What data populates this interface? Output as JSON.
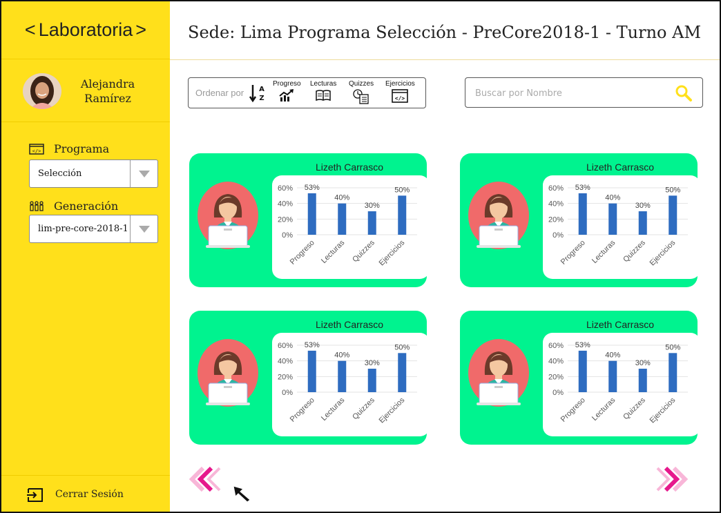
{
  "brand": {
    "name": "Laboratoria",
    "left_chevron": "<",
    "right_chevron": ">"
  },
  "user": {
    "first_name": "Alejandra",
    "last_name": "Ramírez"
  },
  "filters": {
    "programa_label": "Programa",
    "programa_value": "Selección",
    "generacion_label": "Generación",
    "generacion_value": "lim-pre-core-2018-1"
  },
  "logout_label": "Cerrar Sesión",
  "header": {
    "title": "Sede: Lima  Programa Selección - PreCore2018-1 - Turno AM"
  },
  "sort": {
    "label": "Ordenar por",
    "options": [
      "Progreso",
      "Lecturas",
      "Quizzes",
      "Ejercicios"
    ]
  },
  "search": {
    "placeholder": "Buscar por Nombre",
    "value": ""
  },
  "colors": {
    "sidebar": "#FFE01B",
    "card": "#00F38F",
    "bar": "#2E6CC0",
    "pager": "#E6188C"
  },
  "icons": {
    "sort_az": "sort-az-icon",
    "progreso": "trending-up-icon",
    "lecturas": "book-icon",
    "quizzes": "clock-checklist-icon",
    "ejercicios": "code-window-icon",
    "search": "search-icon",
    "logout": "logout-icon",
    "prev": "double-chevron-left-icon",
    "next": "double-chevron-right-icon"
  },
  "students": [
    {
      "name": "Lizeth Carrasco"
    },
    {
      "name": "Lizeth Carrasco"
    },
    {
      "name": "Lizeth Carrasco"
    },
    {
      "name": "Lizeth Carrasco"
    }
  ],
  "chart_data": [
    {
      "type": "bar",
      "categories": [
        "Progreso",
        "Lecturas",
        "Quizzes",
        "Ejercicios"
      ],
      "values": [
        53,
        40,
        30,
        50
      ],
      "data_labels": [
        "53%",
        "40%",
        "30%",
        "50%"
      ],
      "yticks": [
        "0%",
        "20%",
        "40%",
        "60%"
      ],
      "ylim": [
        0,
        60
      ],
      "grid": true
    },
    {
      "type": "bar",
      "categories": [
        "Progreso",
        "Lecturas",
        "Quizzes",
        "Ejercicios"
      ],
      "values": [
        53,
        40,
        30,
        50
      ],
      "data_labels": [
        "53%",
        "40%",
        "30%",
        "50%"
      ],
      "yticks": [
        "0%",
        "20%",
        "40%",
        "60%"
      ],
      "ylim": [
        0,
        60
      ],
      "grid": true
    },
    {
      "type": "bar",
      "categories": [
        "Progreso",
        "Lecturas",
        "Quizzes",
        "Ejercicios"
      ],
      "values": [
        53,
        40,
        30,
        50
      ],
      "data_labels": [
        "53%",
        "40%",
        "30%",
        "50%"
      ],
      "yticks": [
        "0%",
        "20%",
        "40%",
        "60%"
      ],
      "ylim": [
        0,
        60
      ],
      "grid": true
    },
    {
      "type": "bar",
      "categories": [
        "Progreso",
        "Lecturas",
        "Quizzes",
        "Ejercicios"
      ],
      "values": [
        53,
        40,
        30,
        50
      ],
      "data_labels": [
        "53%",
        "40%",
        "30%",
        "50%"
      ],
      "yticks": [
        "0%",
        "20%",
        "40%",
        "60%"
      ],
      "ylim": [
        0,
        60
      ],
      "grid": true
    }
  ]
}
